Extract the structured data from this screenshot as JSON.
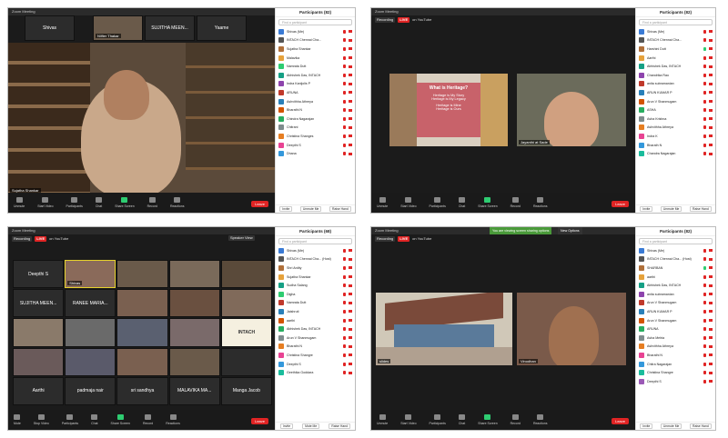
{
  "panels": {
    "q1": {
      "title": "Zoom Meeting",
      "rec": "Recording",
      "strip": [
        "Shivas",
        "Nilfier Thakar",
        "SUJITHA MEEN...",
        "Yaame"
      ],
      "speaker": "Sujatha Shankar",
      "end": "Leave",
      "toolbar": [
        "Unmute",
        "Start Video",
        "Participants",
        "Chat",
        "Share Screen",
        "Record",
        "Reactions"
      ],
      "participants_title": "Participants (82)",
      "find": "Find a participant",
      "list": [
        "Shivas (Me)",
        "INTACH Chennai Cha...",
        "Sujatha Shankar",
        "Malavika",
        "Namrata Dutt",
        "Abhishek Das, INTACH",
        "Indra Kanijolis P",
        "ARUNA",
        "Ashvithha Athreya",
        "Bharathi N",
        "Chindra Nagarajan",
        "Chitrani",
        "Christina Shanges",
        "Deepthi S",
        "Dhana"
      ],
      "footer": [
        "Invite",
        "Unmute Me",
        "Raise Hand"
      ]
    },
    "q2": {
      "title": "Zoom Meeting",
      "rec": "Recording",
      "live": "LIVE",
      "yt": "on YouTube",
      "slide_title": "What is Heritage?",
      "slide_lines": [
        "Heritage is My Story",
        "Heritage is My Legacy",
        "Heritage is Mine",
        "Heritage is Ours"
      ],
      "speaker": "Jayanthi at Sade",
      "end": "Leave",
      "toolbar": [
        "Unmute",
        "Start Video",
        "Participants",
        "Chat",
        "Share Screen",
        "Record",
        "Reactions"
      ],
      "participants_title": "Participants (82)",
      "find": "Find a participant",
      "list": [
        "Shivas (Me)",
        "INTACH Chennai Cha...",
        "Harshini Dutt",
        "Aarthi",
        "Abhishek Das, INTACH",
        "Chandrika Rao",
        "anita subramanian",
        "ARUN KUMAR P",
        "Arun V Shanmugam",
        "ASHA",
        "Asha Krishna",
        "Ashvithha Athreya",
        "Indra K",
        "Bharath N",
        "Chandra Nagarajan"
      ],
      "footer": [
        "Invite",
        "Unmute Me",
        "Raise Hand"
      ]
    },
    "q3": {
      "title": "Zoom Meeting",
      "rec": "Recording",
      "live": "LIVE",
      "yt": "on YouTube",
      "view": "Speaker View",
      "tiles": [
        "Deepthi S",
        "Shivas",
        "",
        "",
        "",
        "SUJITHA MEEN...",
        "RANEE MARIA...",
        "",
        "",
        "",
        "",
        "",
        "",
        "",
        "INTACH",
        "",
        "",
        "",
        "",
        "",
        "Aarthi",
        "padmaja nair",
        "sri sandhya",
        "MALAVIKA MA...",
        "Manga Jacob"
      ],
      "end": "Leave",
      "toolbar": [
        "Mute",
        "Stop Video",
        "Participants",
        "Chat",
        "Share Screen",
        "Record",
        "Reactions"
      ],
      "participants_title": "Participants (68)",
      "find": "Find a participant",
      "list": [
        "Shivas (Me)",
        "INTACH Chennai Cha... (Host)",
        "Shri Ardity",
        "Sujatha Shankar",
        "Sudha Salang",
        "Digha",
        "Namrata Dutt",
        "Jaishruti",
        "aarthi",
        "Abhishek Das, INTACH",
        "Arun V Shanmugam",
        "Bharathi N",
        "Christina Shangre",
        "Deepthi S",
        "Geethika Goddara"
      ],
      "footer": [
        "Invite",
        "Mute Me",
        "Raise Hand"
      ]
    },
    "q4": {
      "title": "Zoom Meeting",
      "rec": "Recording",
      "live": "LIVE",
      "yt": "on YouTube",
      "notice": "You are viewing screen sharing options",
      "new_options": "New Options",
      "left_label": "slides",
      "right_label": "Vinodhan",
      "end": "Leave",
      "toolbar": [
        "Unmute",
        "Start Video",
        "Participants",
        "Chat",
        "Share Screen",
        "Record",
        "Reactions"
      ],
      "participants_title": "Participants (82)",
      "find": "Find a participant",
      "list": [
        "Shivas (Me)",
        "INTACH Chennai Cha... (Host)",
        "SHARBAN",
        "aarthi",
        "Abhishek Das, INTACH",
        "anita subramanian",
        "Arun V Shanmugam",
        "ARUN KUMAR P",
        "Arun V Shanmugam",
        "ARUNA",
        "Asha Mehta",
        "Ashvithha Athreya",
        "Bharathi N",
        "Chitra Nagarajan",
        "Christina Shangre",
        "Deepthi S"
      ],
      "footer": [
        "Invite",
        "Unmute Me",
        "Raise Hand"
      ]
    }
  },
  "colors": {
    "live": "#e02424",
    "green": "#2ecc71",
    "panel_bg": "#ffffff",
    "toolbar": "#1a1a1a"
  }
}
